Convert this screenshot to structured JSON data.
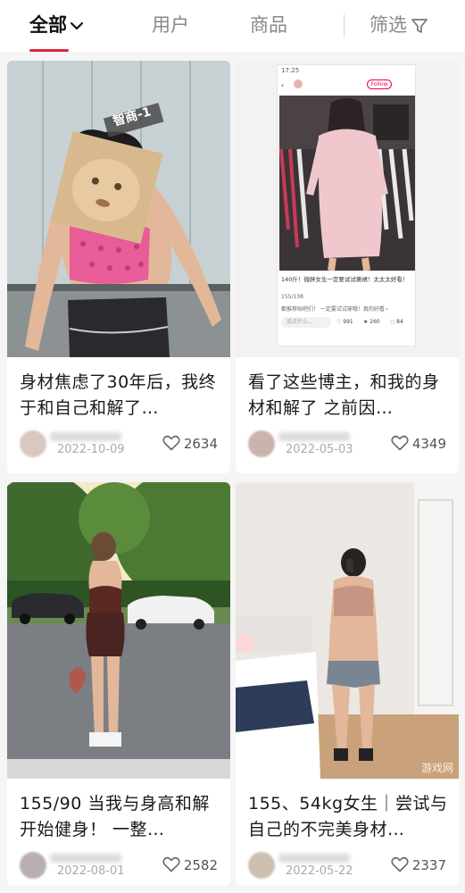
{
  "tabs": [
    {
      "label": "全部",
      "active": true
    },
    {
      "label": "用户",
      "active": false
    },
    {
      "label": "商品",
      "active": false
    }
  ],
  "filter": {
    "label": "筛选"
  },
  "accent_color": "#d8283c",
  "posts": [
    {
      "title": "身材焦虑了30年后，我终于和自己和解了…",
      "date": "2022-10-09",
      "likes": "2634",
      "image_overlay_text": "智商-1"
    },
    {
      "title": "看了这些博主，和我的身材和解了 之前因…",
      "date": "2022-05-03",
      "likes": "4349",
      "screenshot": {
        "status_time": "17:25",
        "follow_label": "Follow",
        "caption": "140斤！微胖女生一定要试试裹裙！太太太好看！",
        "sub": "155/138",
        "comment_line": "都推荐贴吧们！   一定要试试穿哦！真的好看~",
        "input_placeholder": "说点什么...",
        "likes": "991",
        "stars": "260",
        "comments": "84"
      }
    },
    {
      "title": "155/90 当我与身高和解 开始健身！ 一整…",
      "date": "2022-08-01",
      "likes": "2582"
    },
    {
      "title": "155、54kg女生｜尝试与自己的不完美身材…",
      "date": "2022-05-22",
      "likes": "2337",
      "watermark": "游戏网"
    }
  ]
}
